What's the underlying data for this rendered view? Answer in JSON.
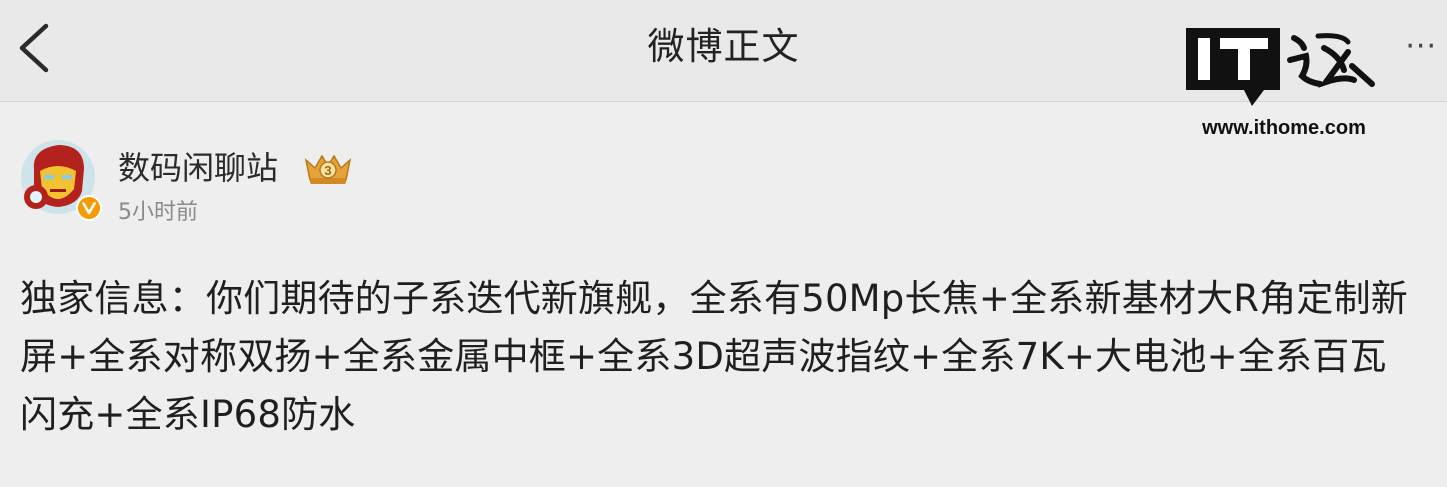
{
  "nav": {
    "title": "微博正文",
    "back_icon": "chevron-left-icon",
    "more_label": "···"
  },
  "watermark": {
    "logo_text": "IT之家",
    "url": "www.ithome.com"
  },
  "post": {
    "author": {
      "name": "数码闲聊站",
      "verified_badge_icon": "verified-v-icon",
      "rank_badge_icon": "crown-rank-badge-icon",
      "rank_level": "3"
    },
    "time": "5小时前",
    "content": "独家信息：你们期待的子系迭代新旗舰，全系有50Mp长焦+全系新基材大R角定制新屏+全系对称双扬+全系金属中框+全系3D超声波指纹+全系7K+大电池+全系百瓦闪充+全系IP68防水"
  },
  "colors": {
    "page_background": "#eeeeee",
    "nav_background": "#e9e9e9",
    "time_text": "#8a8a8a",
    "verified_badge": "#f59b00",
    "rank_badge": "#e6a23c"
  }
}
